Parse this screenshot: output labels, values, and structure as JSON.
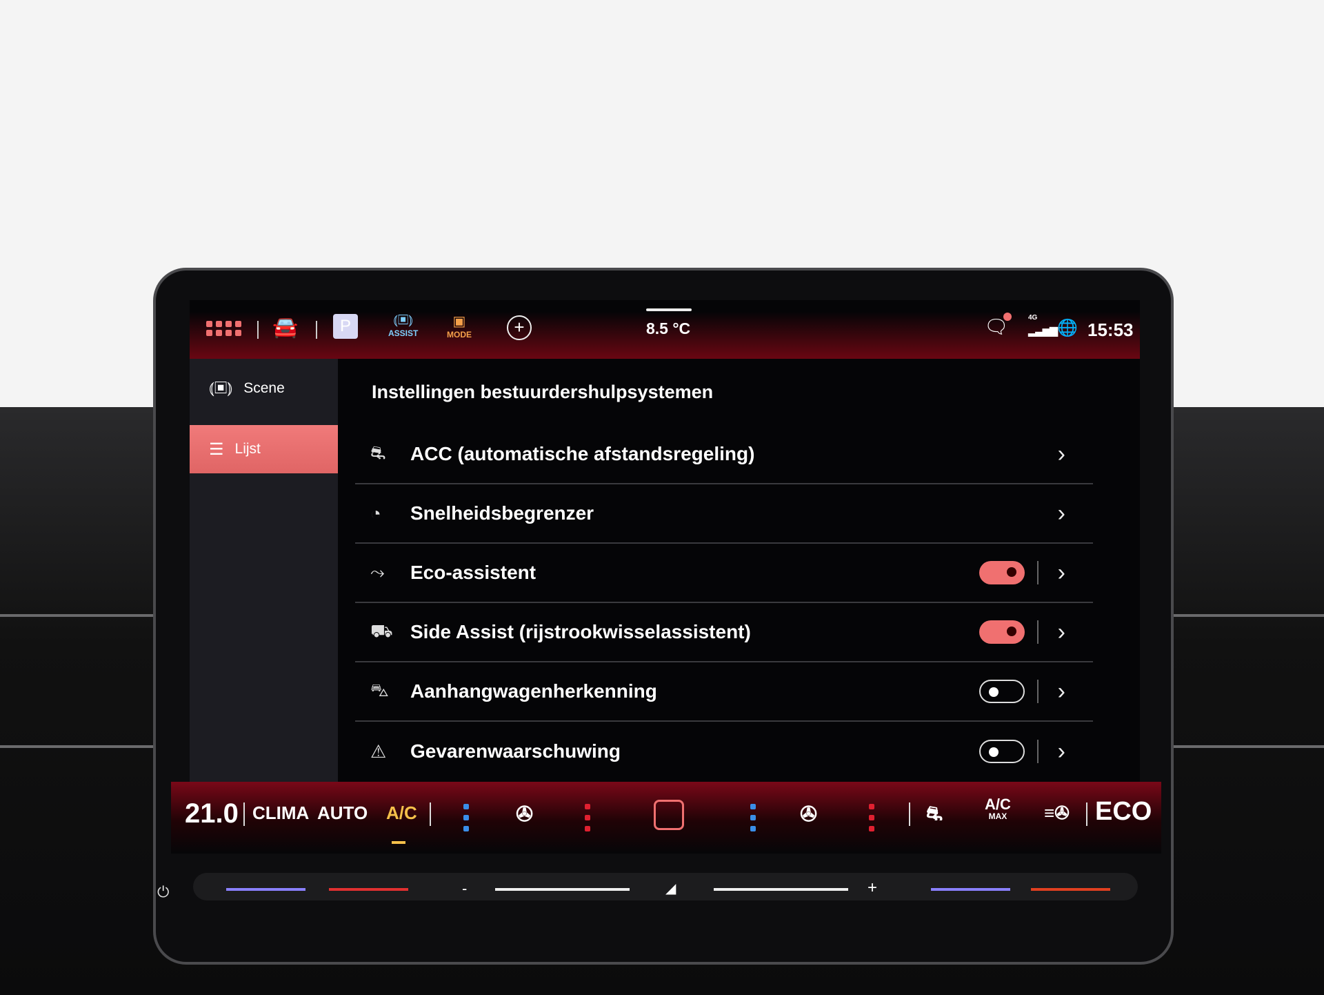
{
  "status_bar": {
    "temperature": "8.5 °C",
    "time": "15:53",
    "network": "4G",
    "assist_label": "ASSIST",
    "mode_label": "MODE",
    "parking_label": "P",
    "notification_dot": true
  },
  "sidebar": {
    "items": [
      {
        "label": "Scene",
        "icon": "car-scene-icon",
        "active": false
      },
      {
        "label": "Lijst",
        "icon": "list-icon",
        "active": true
      }
    ]
  },
  "main": {
    "title": "Instellingen bestuurdershulpsystemen",
    "rows": [
      {
        "label": "ACC (automatische afstandsregeling)",
        "icon": "acc-icon",
        "toggle": null
      },
      {
        "label": "Snelheidsbegrenzer",
        "icon": "speed-limiter-icon",
        "toggle": null
      },
      {
        "label": "Eco-assistent",
        "icon": "eco-assist-icon",
        "toggle": true
      },
      {
        "label": "Side Assist (rijstrookwisselassistent)",
        "icon": "side-assist-icon",
        "toggle": true
      },
      {
        "label": "Aanhangwagenherkenning",
        "icon": "trailer-icon",
        "toggle": false
      },
      {
        "label": "Gevarenwaarschuwing",
        "icon": "hazard-warning-icon",
        "toggle": false
      }
    ]
  },
  "climate": {
    "temp": "21.0",
    "clima": "CLIMA",
    "auto": "AUTO",
    "ac": "A/C",
    "ac_max": "A/C",
    "ac_max_sub": "MAX",
    "eco": "ECO",
    "slider_minus": "-",
    "slider_plus": "+"
  },
  "colors": {
    "accent": "#f07070",
    "ac": "#f5c04a",
    "assist": "#7fd0ff",
    "mode": "#f5a04a"
  }
}
